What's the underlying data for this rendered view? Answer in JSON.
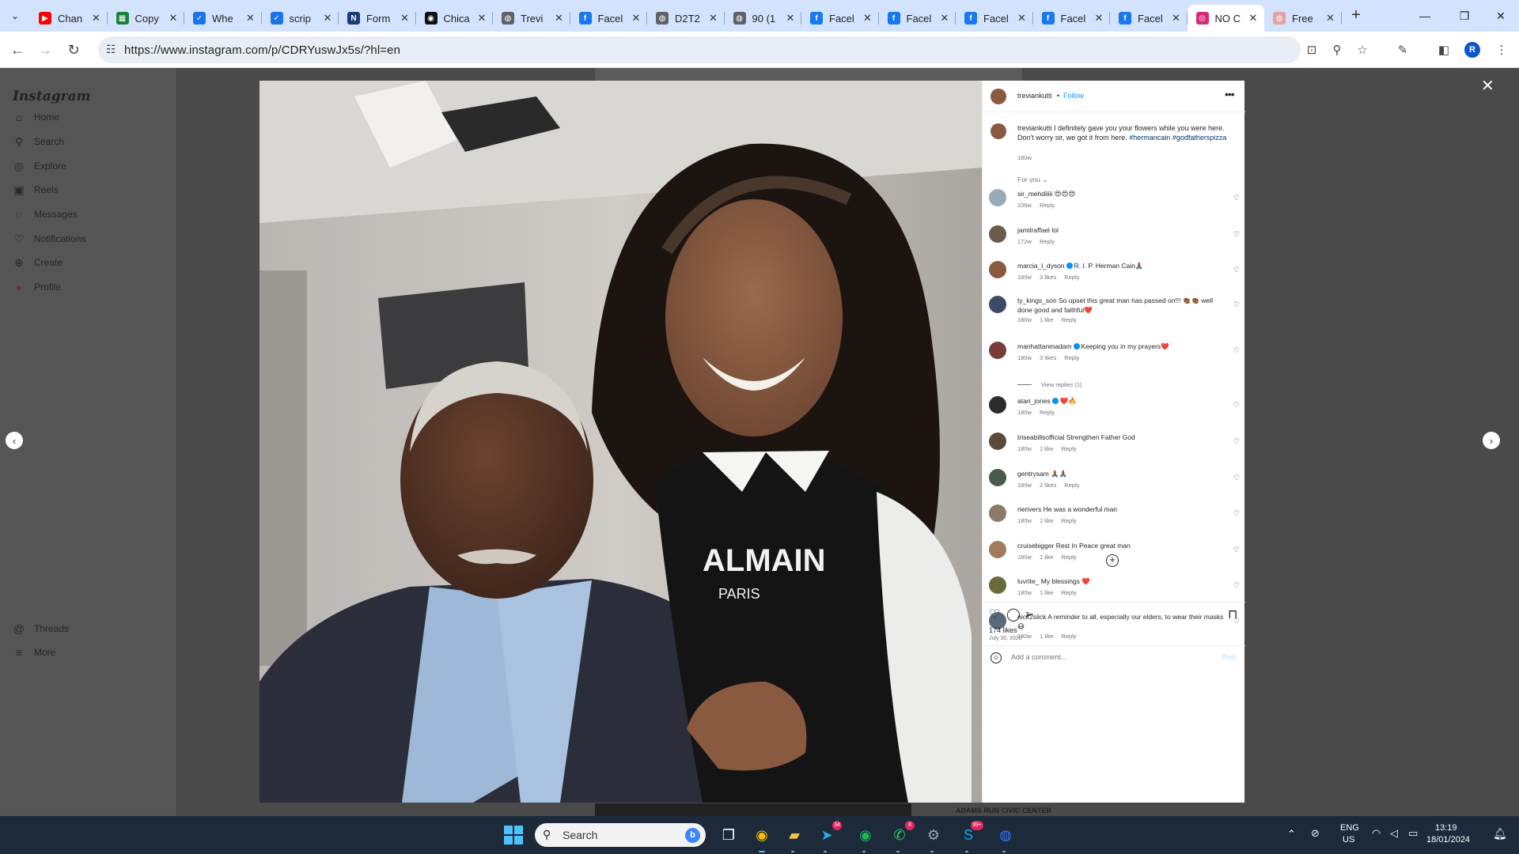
{
  "browser": {
    "tabs": [
      {
        "title": "Chan",
        "favicon": "youtube-icon",
        "color": "#ff0000",
        "glyph": "▶"
      },
      {
        "title": "Copy",
        "favicon": "sheets-icon",
        "color": "#188038",
        "glyph": "▦"
      },
      {
        "title": "Whe",
        "favicon": "clipboard-icon",
        "color": "#1a73e8",
        "glyph": "✓"
      },
      {
        "title": "scrip",
        "favicon": "clipboard-icon",
        "color": "#1a73e8",
        "glyph": "✓"
      },
      {
        "title": "Form",
        "favicon": "news-icon",
        "color": "#1d3b7a",
        "glyph": "N"
      },
      {
        "title": "Chica",
        "favicon": "circle-logo-icon",
        "color": "#111111",
        "glyph": "◉"
      },
      {
        "title": "Trevi",
        "favicon": "globe-icon",
        "color": "#5f6368",
        "glyph": "◍"
      },
      {
        "title": "Facel",
        "favicon": "facebook-icon",
        "color": "#1877f2",
        "glyph": "f"
      },
      {
        "title": "D2T2",
        "favicon": "globe-icon",
        "color": "#5f6368",
        "glyph": "◍"
      },
      {
        "title": "90 (1",
        "favicon": "globe-icon",
        "color": "#5f6368",
        "glyph": "◍"
      },
      {
        "title": "Facel",
        "favicon": "facebook-icon",
        "color": "#1877f2",
        "glyph": "f"
      },
      {
        "title": "Facel",
        "favicon": "facebook-icon",
        "color": "#1877f2",
        "glyph": "f"
      },
      {
        "title": "Facel",
        "favicon": "facebook-icon",
        "color": "#1877f2",
        "glyph": "f"
      },
      {
        "title": "Facel",
        "favicon": "facebook-icon",
        "color": "#1877f2",
        "glyph": "f"
      },
      {
        "title": "Facel",
        "favicon": "facebook-icon",
        "color": "#1877f2",
        "glyph": "f"
      },
      {
        "title": "NO C",
        "favicon": "instagram-icon",
        "color": "#d62976",
        "glyph": "◎",
        "active": true
      },
      {
        "title": "Free",
        "favicon": "globe-icon",
        "color": "#e8a0a0",
        "glyph": "◍"
      }
    ],
    "url": "https://www.instagram.com/p/CDRYuswJx5s/?hl=en",
    "profile_initial": "R"
  },
  "instagram": {
    "logo": "Instagram",
    "nav": [
      {
        "label": "Home",
        "icon": "home-icon",
        "glyph": "⌂"
      },
      {
        "label": "Search",
        "icon": "search-icon",
        "glyph": "⚲"
      },
      {
        "label": "Explore",
        "icon": "compass-icon",
        "glyph": "◎"
      },
      {
        "label": "Reels",
        "icon": "reels-icon",
        "glyph": "▣"
      },
      {
        "label": "Messages",
        "icon": "messenger-icon",
        "glyph": "◌"
      },
      {
        "label": "Notifications",
        "icon": "heart-icon",
        "glyph": "♡"
      },
      {
        "label": "Create",
        "icon": "plus-square-icon",
        "glyph": "⊕"
      },
      {
        "label": "Profile",
        "icon": "profile-avatar-icon",
        "glyph": "●"
      }
    ],
    "nav_bottom": [
      {
        "label": "Threads",
        "icon": "threads-icon",
        "glyph": "@"
      },
      {
        "label": "More",
        "icon": "menu-icon",
        "glyph": "≡"
      }
    ],
    "background_caption": "ADAMS RUN CIVIC CENTER",
    "post": {
      "username": "treviankutti",
      "follow": "Follow",
      "caption_user": "treviankutti",
      "caption": "I definitely gave you your flowers while you were here. Don't worry sir, we got it from here.",
      "hashtags": "#hermancain #godfatherspizza",
      "caption_time": "180w",
      "filter": "For you",
      "likes": "174 likes",
      "date": "July 30, 2020",
      "add_comment_placeholder": "Add a comment...",
      "post_label": "Post"
    },
    "comments": [
      {
        "user": "sir_mehdiiiii",
        "text": "😍😍😍",
        "time": "106w",
        "likes": "",
        "avatar": "#9aa9b8"
      },
      {
        "user": "jamilraffael",
        "text": "lol",
        "time": "172w",
        "likes": "",
        "avatar": "#6b5a4d"
      },
      {
        "user": "marcia_l_dyson",
        "verified": true,
        "text": "R. I. P. Herman Cain🙏🏾",
        "time": "180w",
        "likes": "3 likes",
        "avatar": "#8a5a40"
      },
      {
        "user": "ty_kings_son",
        "text": "So upset this great man has passed on!!! 👏🏾👏🏾 well done good and faithful❤️",
        "time": "180w",
        "likes": "1 like",
        "avatar": "#3d4a66"
      },
      {
        "user": "manhattanmadam",
        "verified": true,
        "text": "Keeping you in my prayers❤️",
        "time": "180w",
        "likes": "3 likes",
        "avatar": "#7a3b3b",
        "view_replies": "View replies (1)"
      },
      {
        "user": "atari_jones",
        "verified": true,
        "text": "❤️🔥",
        "time": "180w",
        "likes": "",
        "avatar": "#2c2c2c"
      },
      {
        "user": "triseabillsofficial",
        "text": "Strengthen Father God",
        "time": "180w",
        "likes": "1 like",
        "avatar": "#5b4a3a"
      },
      {
        "user": "gentrysam",
        "text": "🙏🏾🙏🏾",
        "time": "180w",
        "likes": "2 likes",
        "avatar": "#4a5a4a"
      },
      {
        "user": "rierivers",
        "text": "He was a wonderful man",
        "time": "180w",
        "likes": "1 like",
        "avatar": "#8c7b6b"
      },
      {
        "user": "cruisebigger",
        "text": "Rest In Peace great man",
        "time": "180w",
        "likes": "1 like",
        "avatar": "#a07a5a"
      },
      {
        "user": "luvrite_",
        "text": "My blessings ❤️",
        "time": "180w",
        "likes": "1 like",
        "avatar": "#6a6a3a"
      },
      {
        "user": "nick2slick",
        "text": "A reminder to all, especially our elders, to wear their masks 😷",
        "time": "180w",
        "likes": "1 like",
        "avatar": "#5a6a7a"
      }
    ],
    "reply_label": "Reply"
  },
  "taskbar": {
    "search_placeholder": "Search",
    "apps": [
      {
        "name": "task-view-icon",
        "glyph": "❐",
        "color": "#ffffff"
      },
      {
        "name": "chrome-icon",
        "glyph": "◉",
        "color": "#fbbc04",
        "running": true
      },
      {
        "name": "file-explorer-icon",
        "glyph": "▰",
        "color": "#f4c542"
      },
      {
        "name": "telegram-icon",
        "glyph": "➤",
        "color": "#2aabee",
        "badge": "34"
      },
      {
        "name": "spotify-icon",
        "glyph": "◉",
        "color": "#1db954"
      },
      {
        "name": "whatsapp-icon",
        "glyph": "✆",
        "color": "#25d366",
        "badge": "8"
      },
      {
        "name": "settings-icon",
        "glyph": "⚙",
        "color": "#9aa7b5"
      },
      {
        "name": "skype-icon",
        "glyph": "S",
        "color": "#00aff0",
        "badge": "99+"
      },
      {
        "name": "signal-icon",
        "glyph": "◍",
        "color": "#3a76f0"
      }
    ],
    "language_top": "ENG",
    "language_bottom": "US",
    "time": "13:19",
    "date": "18/01/2024"
  }
}
